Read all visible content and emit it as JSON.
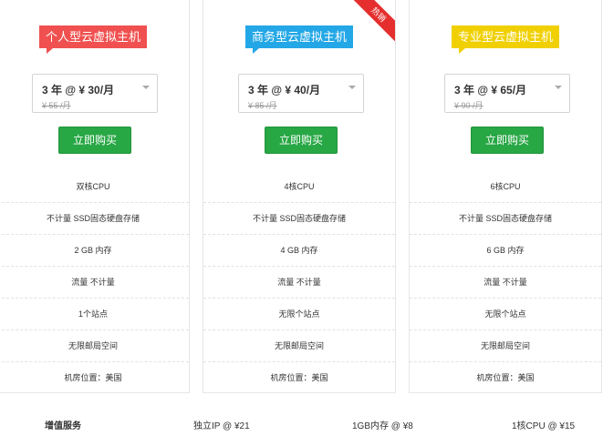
{
  "plans": [
    {
      "name": "个人型云虚拟主机",
      "price_main": "3 年 @ ¥ 30/月",
      "price_old": "¥ 55 /月",
      "buy_label": "立即购买",
      "features": [
        "双核CPU",
        "不计量 SSD固态硬盘存储",
        "2 GB 内存",
        "流量 不计量",
        "1个站点",
        "无限邮局空间",
        "机房位置：美国"
      ]
    },
    {
      "name": "商务型云虚拟主机",
      "badge": "热销",
      "price_main": "3 年 @ ¥ 40/月",
      "price_old": "¥ 85 /月",
      "buy_label": "立即购买",
      "features": [
        "4核CPU",
        "不计量 SSD固态硬盘存储",
        "4 GB 内存",
        "流量 不计量",
        "无限个站点",
        "无限邮局空间",
        "机房位置：美国"
      ]
    },
    {
      "name": "专业型云虚拟主机",
      "price_main": "3 年 @ ¥ 65/月",
      "price_old": "¥ 90 /月",
      "buy_label": "立即购买",
      "features": [
        "6核CPU",
        "不计量 SSD固态硬盘存储",
        "6 GB 内存",
        "流量 不计量",
        "无限个站点",
        "无限邮局空间",
        "机房位置：美国"
      ]
    }
  ],
  "addons": {
    "label": "增值服务",
    "items": [
      "独立IP @ ¥21",
      "1GB内存 @ ¥8",
      "1核CPU @ ¥15"
    ]
  },
  "colors": {
    "tag_personal": "#f05050",
    "tag_business": "#23a7e6",
    "tag_pro": "#f0d000",
    "buy_button": "#28a745",
    "hot_ribbon": "#e52e2e"
  }
}
